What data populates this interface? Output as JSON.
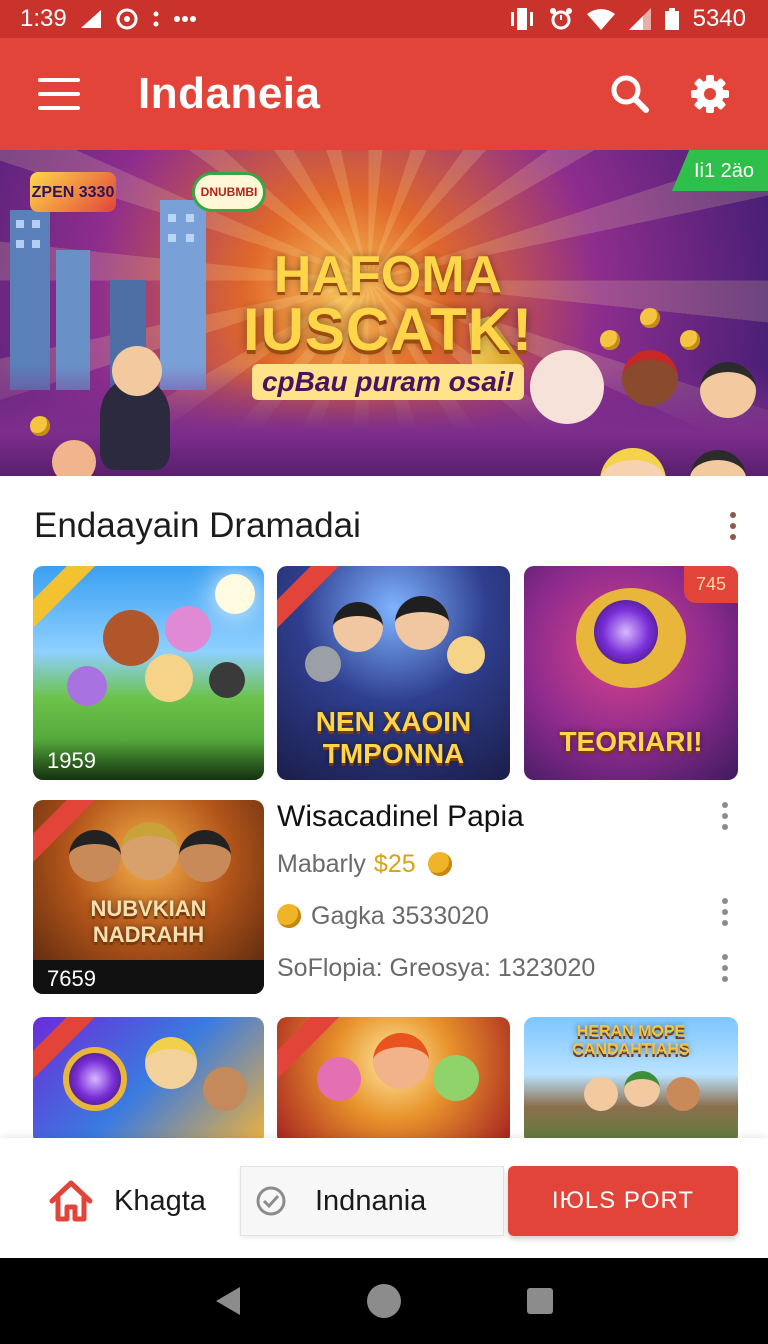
{
  "status_bar": {
    "time": "1:39",
    "battery_text": "5340"
  },
  "app_bar": {
    "title": "Indaneia"
  },
  "banner": {
    "corner_tag": "Ii1 2äo",
    "logo_left": "ZPEN 3330",
    "logo_center": "DNUBMBI",
    "headline_line1": "HAFOMA",
    "headline_line2": "IUSCATK!",
    "subline": "cpBau puram osai!"
  },
  "section": {
    "title": "Endaayain Dramadai"
  },
  "cards_row1": [
    {
      "caption": "1959",
      "corner": ""
    },
    {
      "title": "NEN XAOIN TMPONNA",
      "corner": ""
    },
    {
      "title": "TEORIARI!",
      "badge": "745"
    }
  ],
  "featured": {
    "thumb_title": "NUBVKIAN NADRAHH",
    "thumb_caption": "7659",
    "title": "Wisacadinel Papia",
    "row1_label": "Mabarly",
    "row1_price": "$25",
    "row2_text": "Gagka 3533020",
    "row3_text": "SoFlopia: Greosya: 1323020"
  },
  "cards_row2": [
    {
      "title": ""
    },
    {
      "title": ""
    },
    {
      "title": "HERAN MOPE CANDAHTIAHS"
    }
  ],
  "bottom_bar": {
    "home_label": "Khagta",
    "middle_label": "Indnania",
    "primary_label": "IЮLS PORT"
  },
  "colors": {
    "primary": "#e2443a",
    "status": "#c9332b",
    "gold": "#d9a21b"
  },
  "icons": [
    "menu-icon",
    "search-icon",
    "gear-icon",
    "home-icon",
    "check-circle-icon",
    "back-icon",
    "home-circle-icon",
    "recents-icon"
  ]
}
